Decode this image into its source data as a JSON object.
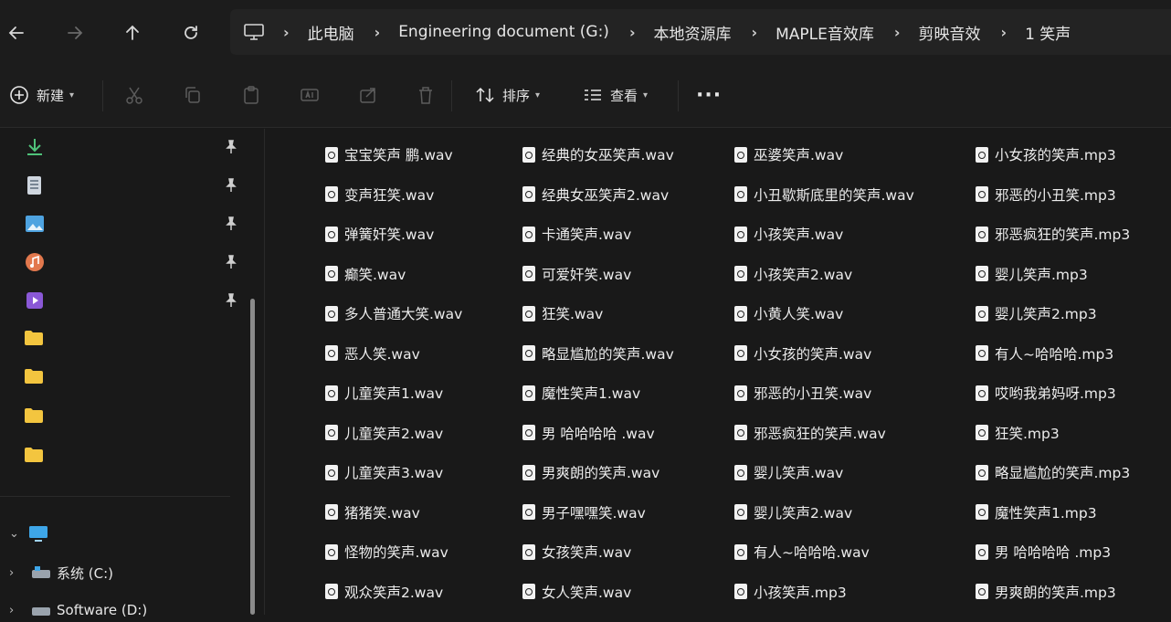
{
  "nav": {
    "back_icon": "arrow-left-icon",
    "forward_icon": "arrow-right-icon",
    "up_icon": "arrow-up-icon",
    "refresh_icon": "refresh-icon"
  },
  "breadcrumb": [
    "此电脑",
    "Engineering document (G:)",
    "本地资源库",
    "MAPLE音效库",
    "剪映音效",
    "1 笑声"
  ],
  "toolbar": {
    "new_label": "新建",
    "sort_label": "排序",
    "view_label": "查看",
    "more_label": "···"
  },
  "sidebar": {
    "drives": [
      {
        "label": "系统 (C:)"
      },
      {
        "label": "Software (D:)"
      }
    ]
  },
  "files": [
    [
      "宝宝笑声 鹏.wav",
      "经典的女巫笑声.wav",
      "巫婆笑声.wav",
      "小女孩的笑声.mp3"
    ],
    [
      "变声狂笑.wav",
      "经典女巫笑声2.wav",
      "小丑歇斯底里的笑声.wav",
      "邪恶的小丑笑.mp3"
    ],
    [
      "弹簧奸笑.wav",
      "卡通笑声.wav",
      "小孩笑声.wav",
      "邪恶疯狂的笑声.mp3"
    ],
    [
      "癫笑.wav",
      "可爱奸笑.wav",
      "小孩笑声2.wav",
      "婴儿笑声.mp3"
    ],
    [
      "多人普通大笑.wav",
      "狂笑.wav",
      "小黄人笑.wav",
      "婴儿笑声2.mp3"
    ],
    [
      "恶人笑.wav",
      "略显尴尬的笑声.wav",
      "小女孩的笑声.wav",
      "有人~哈哈哈.mp3"
    ],
    [
      "儿童笑声1.wav",
      "魔性笑声1.wav",
      "邪恶的小丑笑.wav",
      "哎哟我弟妈呀.mp3"
    ],
    [
      "儿童笑声2.wav",
      "男 哈哈哈哈 .wav",
      "邪恶疯狂的笑声.wav",
      "狂笑.mp3"
    ],
    [
      "儿童笑声3.wav",
      "男爽朗的笑声.wav",
      "婴儿笑声.wav",
      "略显尴尬的笑声.mp3"
    ],
    [
      "猪猪笑.wav",
      "男子嘿嘿笑.wav",
      "婴儿笑声2.wav",
      "魔性笑声1.mp3"
    ],
    [
      "怪物的笑声.wav",
      "女孩笑声.wav",
      "有人~哈哈哈.wav",
      "男 哈哈哈哈 .mp3"
    ],
    [
      "观众笑声2.wav",
      "女人笑声.wav",
      "小孩笑声.mp3",
      "男爽朗的笑声.mp3"
    ]
  ]
}
